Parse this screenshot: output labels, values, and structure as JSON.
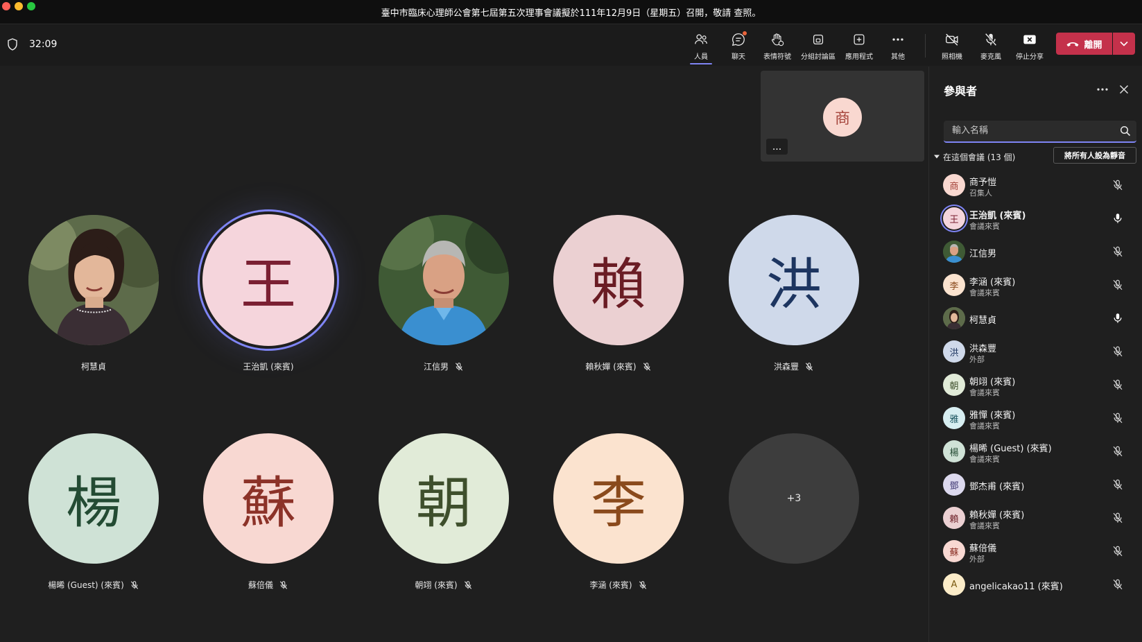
{
  "window": {
    "title": "臺中市臨床心理師公會第七屆第五次理事會議擬於111年12月9日（星期五）召開，敬請 查照。"
  },
  "toolbar": {
    "timer": "32:09",
    "people_label": "人員",
    "chat_label": "聊天",
    "reactions_label": "表情符號",
    "rooms_label": "分組討論區",
    "apps_label": "應用程式",
    "more_label": "其他",
    "camera_label": "照相機",
    "mic_label": "麥克風",
    "stop_share_label": "停止分享",
    "leave_label": "離開"
  },
  "stage": {
    "self_view_initial": "商",
    "self_view_more": "...",
    "tiles": [
      {
        "name": "柯慧貞",
        "initial": "",
        "type": "photo-woman",
        "muted": false
      },
      {
        "name": "王治凱 (來賓)",
        "initial": "王",
        "bg": "#f5d5dc",
        "fg": "#7a1f32",
        "muted": false,
        "speaking": true
      },
      {
        "name": "江信男",
        "initial": "",
        "type": "photo-man",
        "muted": true
      },
      {
        "name": "賴秋嬋 (來賓)",
        "initial": "賴",
        "bg": "#ebd0d2",
        "fg": "#6a1c24",
        "muted": true
      },
      {
        "name": "洪森豐",
        "initial": "洪",
        "bg": "#cfd9ea",
        "fg": "#1d3560",
        "muted": true
      },
      {
        "name": "楊晞 (Guest) (來賓)",
        "initial": "楊",
        "bg": "#cfe2d6",
        "fg": "#234b33",
        "muted": true
      },
      {
        "name": "蘇倍儀",
        "initial": "蘇",
        "bg": "#f8d8d2",
        "fg": "#8c3228",
        "muted": true
      },
      {
        "name": "朝翊 (來賓)",
        "initial": "朝",
        "bg": "#e1ebd8",
        "fg": "#3e4f2c",
        "muted": true
      },
      {
        "name": "李涵 (來賓)",
        "initial": "李",
        "bg": "#fbe3cf",
        "fg": "#8a4a1c",
        "muted": true
      }
    ],
    "overflow_label": "+3"
  },
  "panel": {
    "title": "參與者",
    "search_placeholder": "輸入名稱",
    "section_label": "在這個會議 (13 個)",
    "mute_all_label": "將所有人設為靜音",
    "participants": [
      {
        "name": "商予愷",
        "role": "召集人",
        "initial": "商",
        "bg": "#f9d8d0",
        "fg": "#a5443b",
        "mic": "muted"
      },
      {
        "name": "王治凱 (來賓)",
        "role": "會議來賓",
        "initial": "王",
        "bg": "#f5d5dc",
        "fg": "#7a1f32",
        "mic": "on",
        "speaking": true
      },
      {
        "name": "江信男",
        "role": "",
        "initial": "",
        "photo": "man",
        "mic": "muted"
      },
      {
        "name": "李涵 (來賓)",
        "role": "會議來賓",
        "initial": "李",
        "bg": "#fbe3cf",
        "fg": "#8a4a1c",
        "mic": "muted"
      },
      {
        "name": "柯慧貞",
        "role": "",
        "initial": "",
        "photo": "woman",
        "mic": "on"
      },
      {
        "name": "洪森豐",
        "role": "外部",
        "initial": "洪",
        "bg": "#cfd9ea",
        "fg": "#1d3560",
        "mic": "muted"
      },
      {
        "name": "朝翊 (來賓)",
        "role": "會議來賓",
        "initial": "朝",
        "bg": "#e1ebd8",
        "fg": "#3e4f2c",
        "mic": "muted"
      },
      {
        "name": "雅憚 (來賓)",
        "role": "會議來賓",
        "initial": "雅",
        "bg": "#d7eef1",
        "fg": "#1c5560",
        "mic": "muted"
      },
      {
        "name": "楊晞 (Guest) (來賓)",
        "role": "會議來賓",
        "initial": "楊",
        "bg": "#cfe2d6",
        "fg": "#234b33",
        "mic": "muted"
      },
      {
        "name": "鄧杰甫 (來賓)",
        "role": "",
        "initial": "鄧",
        "bg": "#dcd9ee",
        "fg": "#3b3470",
        "mic": "muted"
      },
      {
        "name": "賴秋嬋 (來賓)",
        "role": "會議來賓",
        "initial": "賴",
        "bg": "#ebd0d2",
        "fg": "#6a1c24",
        "mic": "muted"
      },
      {
        "name": "蘇倍儀",
        "role": "外部",
        "initial": "蘇",
        "bg": "#f8d8d2",
        "fg": "#8c3228",
        "mic": "muted"
      },
      {
        "name": "angelicakao11 (來賓)",
        "role": "",
        "initial": "A",
        "bg": "#fbecc8",
        "fg": "#7a5a10",
        "mic": "muted"
      }
    ]
  },
  "colors": {
    "accent": "#7f85f5",
    "leave": "#c4314b",
    "background": "#1f1f1f"
  }
}
